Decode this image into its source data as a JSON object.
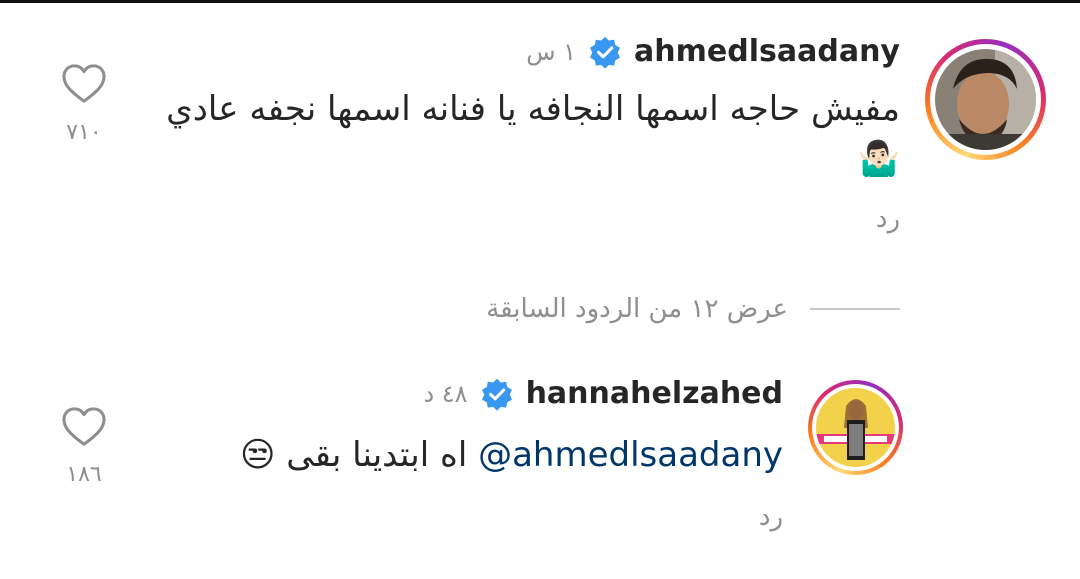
{
  "comments": [
    {
      "username": "ahmedlsaadany",
      "time": "١ س",
      "text_line1": "مفيش حاجه اسمها النجافه يا فنانه اسمها نجفه عادي",
      "emoji": "🤷🏻‍♂️",
      "reply_label": "رد",
      "likes": "٧١٠"
    },
    {
      "username": "hannahelzahed",
      "time": "٤٨ د",
      "mention": "@ahmedlsaadany",
      "text": " اه ابتدينا بقى ",
      "emoji": "😒",
      "reply_label": "رد",
      "likes": "١٨٦"
    }
  ],
  "view_replies": "عرض ١٢ من الردود السابقة",
  "colors": {
    "verified": "#3897f0",
    "mention": "#00376b",
    "muted": "#8e8e8e"
  },
  "icons": [
    "heart-icon",
    "verified-badge-icon",
    "avatar"
  ]
}
